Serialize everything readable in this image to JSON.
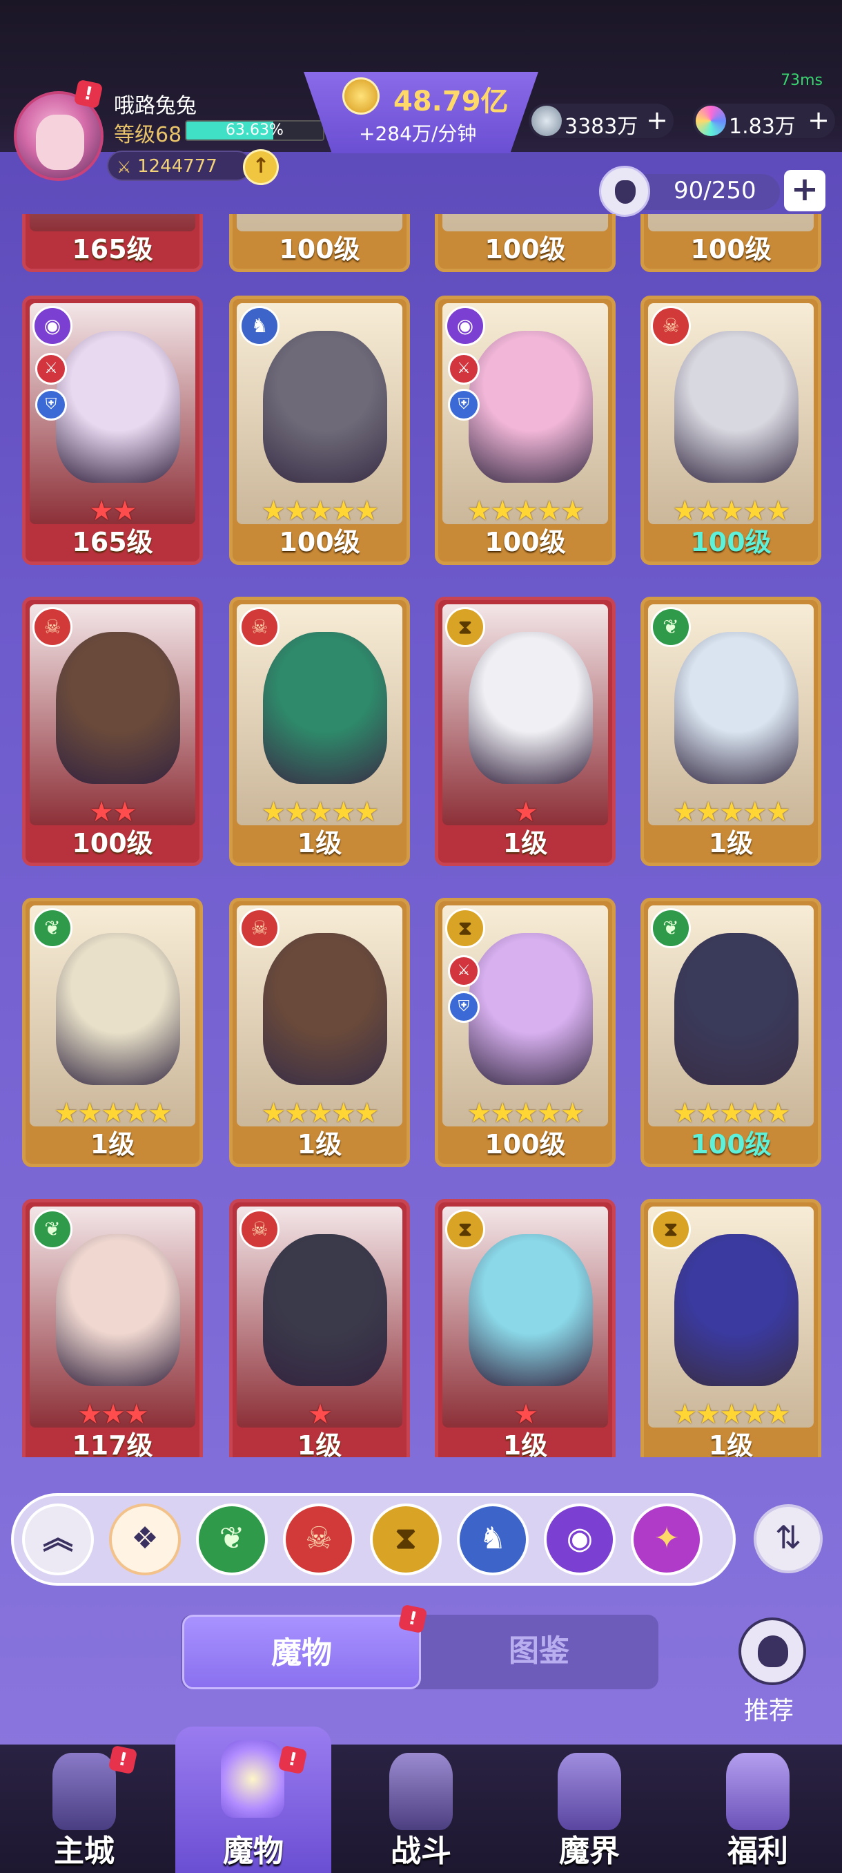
{
  "status": {
    "fps": "73ms"
  },
  "player": {
    "name": "哦路兔兔",
    "level_label": "等级68",
    "xp_percent_text": "63.63%",
    "xp_fraction": 0.6363,
    "power": "1244777",
    "upgrade_icon": "arrow-up-icon",
    "alert": "!"
  },
  "currency": {
    "gold": "48.79亿",
    "gold_rate": "+284万/分钟",
    "gem": "3383万",
    "crystal": "1.83万"
  },
  "capacity": {
    "text": "90/250",
    "plus": "+"
  },
  "cards_top_row": [
    "165级",
    "100级",
    "100级",
    "100级"
  ],
  "cards": [
    {
      "level": "165级",
      "stars": "★★",
      "frame": "red",
      "faction": "eye"
    },
    {
      "level": "100级",
      "stars": "★★★★★",
      "frame": "gold",
      "faction": "dragon"
    },
    {
      "level": "100级",
      "stars": "★★★★★",
      "frame": "gold",
      "faction": "eye"
    },
    {
      "level": "100级",
      "stars": "★★★★★",
      "frame": "gold",
      "faction": "fire",
      "teal": true
    },
    {
      "level": "100级",
      "stars": "★★",
      "frame": "red",
      "faction": "fire"
    },
    {
      "level": "1级",
      "stars": "★★★★★",
      "frame": "gold",
      "faction": "fire"
    },
    {
      "level": "1级",
      "stars": "★",
      "frame": "red",
      "faction": "hour"
    },
    {
      "level": "1级",
      "stars": "★★★★★",
      "frame": "gold",
      "faction": "leaf"
    },
    {
      "level": "1级",
      "stars": "★★★★★",
      "frame": "gold",
      "faction": "leaf"
    },
    {
      "level": "1级",
      "stars": "★★★★★",
      "frame": "gold",
      "faction": "fire"
    },
    {
      "level": "100级",
      "stars": "★★★★★",
      "frame": "gold",
      "faction": "hour"
    },
    {
      "level": "100级",
      "stars": "★★★★★",
      "frame": "gold",
      "faction": "leaf",
      "teal": true
    },
    {
      "level": "117级",
      "stars": "★★★",
      "frame": "red",
      "faction": "leaf"
    },
    {
      "level": "1级",
      "stars": "★",
      "frame": "red",
      "faction": "fire"
    },
    {
      "level": "1级",
      "stars": "★",
      "frame": "red",
      "faction": "hour"
    },
    {
      "level": "1级",
      "stars": "★★★★★",
      "frame": "gold",
      "faction": "hour"
    }
  ],
  "filters": [
    "collapse",
    "all",
    "leaf",
    "fire",
    "hourglass",
    "dragon",
    "eye",
    "star"
  ],
  "tabs": {
    "monsters": "魔物",
    "codex": "图鉴",
    "recommend": "推荐"
  },
  "nav": {
    "main_city": "主城",
    "monsters": "魔物",
    "battle": "战斗",
    "demon_realm": "魔界",
    "welfare": "福利"
  },
  "colors": {
    "gold_frame": "#d39b45",
    "red_frame": "#c84453",
    "accent": "#8a70ef"
  }
}
